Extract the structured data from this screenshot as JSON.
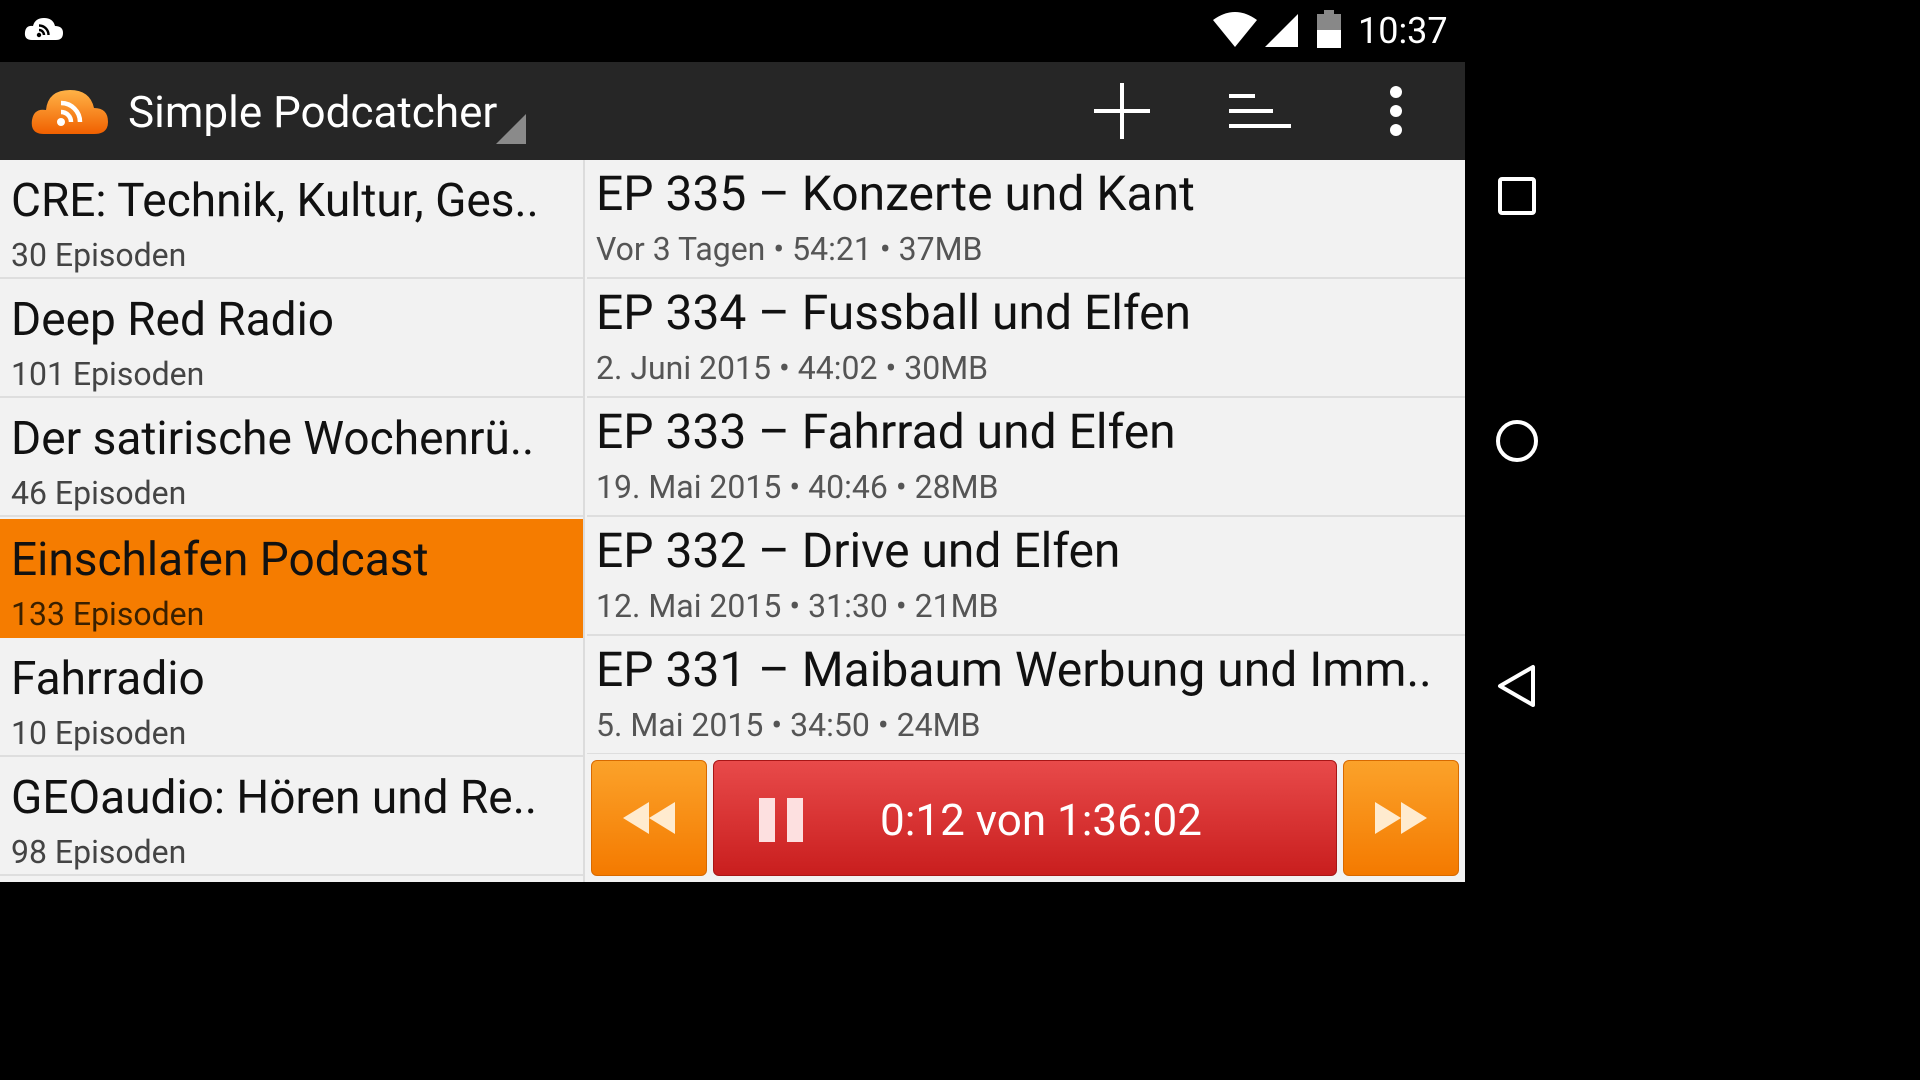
{
  "status_bar": {
    "time": "10:37",
    "icons": [
      "podcast-notification-icon",
      "wifi-icon",
      "signal-icon",
      "battery-icon"
    ]
  },
  "action_bar": {
    "title": "Simple Podcatcher",
    "actions": [
      "add-icon",
      "sort-icon",
      "overflow-menu-icon"
    ]
  },
  "podcasts": [
    {
      "title": "CRE: Technik, Kultur, Ges..",
      "count": "30 Episoden",
      "selected": false
    },
    {
      "title": "Deep Red Radio",
      "count": "101 Episoden",
      "selected": false
    },
    {
      "title": "Der satirische Wochenrü..",
      "count": "46 Episoden",
      "selected": false
    },
    {
      "title": "Einschlafen Podcast",
      "count": "133 Episoden",
      "selected": true
    },
    {
      "title": "Fahrradio",
      "count": "10 Episoden",
      "selected": false
    },
    {
      "title": "GEOaudio: Hören und Re..",
      "count": "98 Episoden",
      "selected": false
    }
  ],
  "episodes": [
    {
      "title": "EP 335 – Konzerte und Kant",
      "date": "Vor 3 Tagen",
      "duration": "54:21",
      "size": "37MB"
    },
    {
      "title": "EP 334 – Fussball und Elfen",
      "date": "2. Juni 2015",
      "duration": "44:02",
      "size": "30MB"
    },
    {
      "title": "EP 333 – Fahrrad und Elfen",
      "date": "19. Mai 2015",
      "duration": "40:46",
      "size": "28MB"
    },
    {
      "title": "EP 332 – Drive und Elfen",
      "date": "12. Mai 2015",
      "duration": "31:30",
      "size": "21MB"
    },
    {
      "title": "EP 331 – Maibaum Werbung und Imm..",
      "date": "5. Mai 2015",
      "duration": "34:50",
      "size": "24MB"
    }
  ],
  "player": {
    "progress": "0:12 von 1:36:02",
    "buttons": [
      "rewind-icon",
      "pause-icon",
      "fast-forward-icon"
    ]
  },
  "nav_bar": {
    "buttons": [
      "recents-icon",
      "home-icon",
      "back-icon"
    ]
  },
  "colors": {
    "accent_orange": "#f57c00",
    "play_red": "#d32f2f",
    "action_bar": "#262626"
  }
}
